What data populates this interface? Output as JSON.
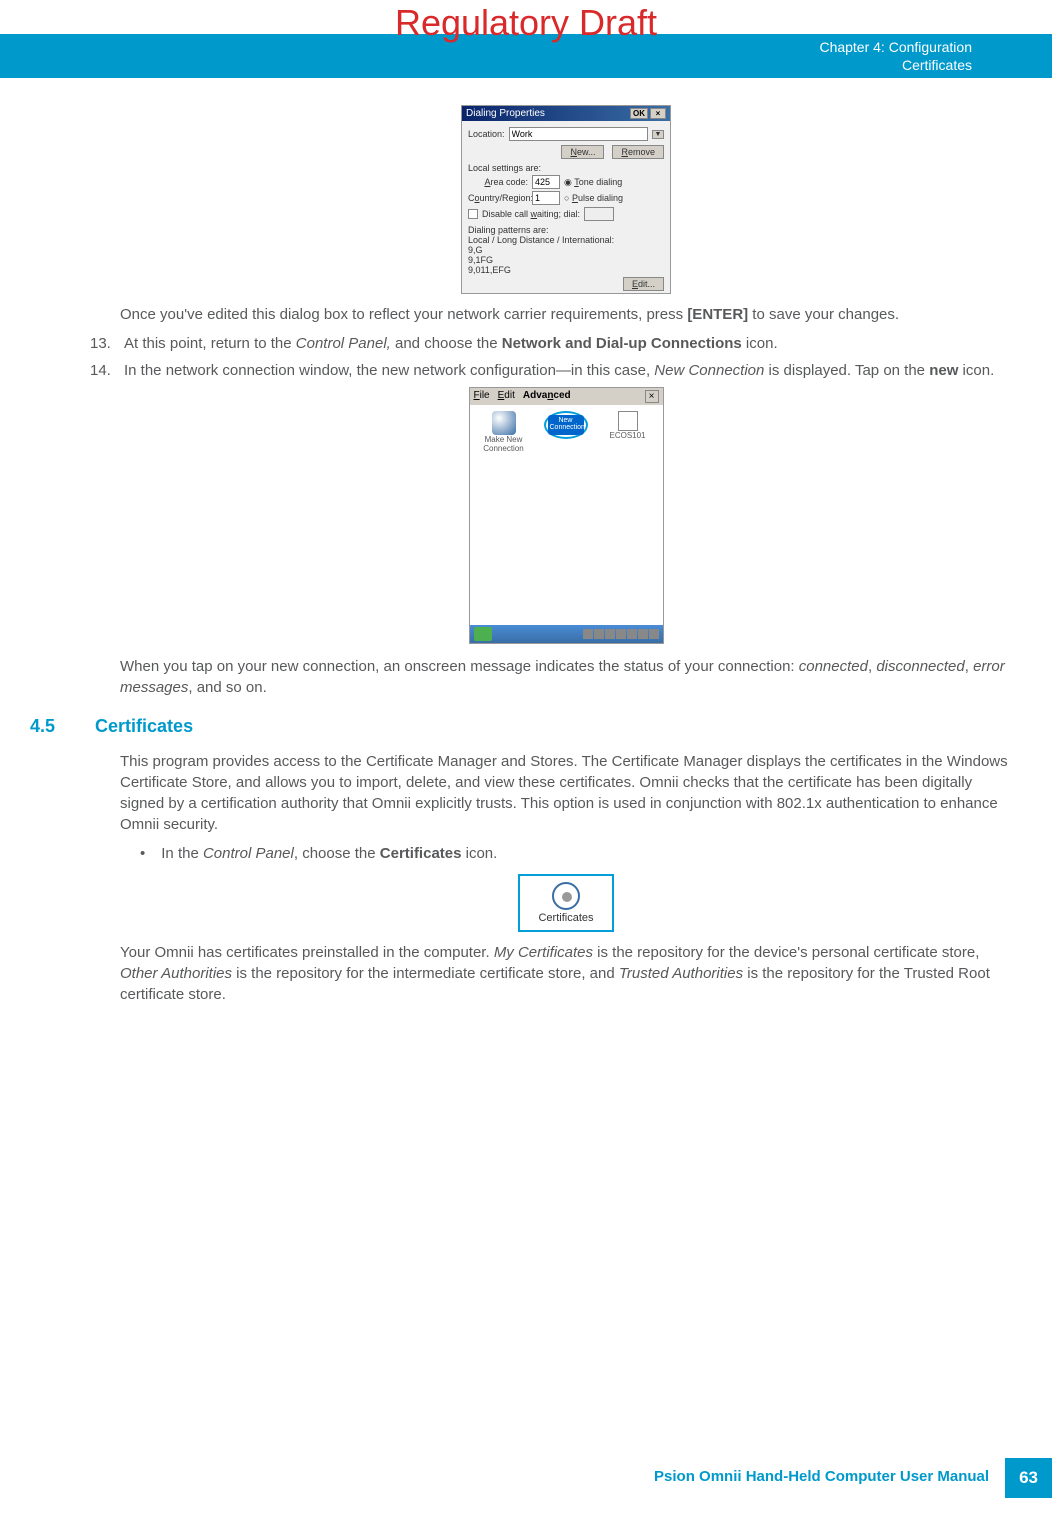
{
  "watermark": "Regulatory Draft",
  "header": {
    "chapter": "Chapter 4:  Configuration",
    "section": "Certificates"
  },
  "dialog1": {
    "title": "Dialing Properties",
    "ok": "OK",
    "close": "×",
    "location_label": "Location:",
    "location_value": "Work",
    "new_btn": "New...",
    "remove_btn": "Remove",
    "local_settings": "Local settings are:",
    "area_code_label": "Area code:",
    "area_code_value": "425",
    "country_label": "Country/Region:",
    "country_value": "1",
    "tone": "Tone dialing",
    "pulse": "Pulse dialing",
    "disable_wait": "Disable call waiting; dial:",
    "patterns_label": "Dialing patterns are:",
    "patterns_sub": "Local / Long Distance / International:",
    "p1": "9,G",
    "p2": "9,1FG",
    "p3": "9,011,EFG",
    "edit_btn": "Edit..."
  },
  "para1_pre": "Once you've edited this dialog box to reflect your network carrier requirements, press ",
  "para1_enter": "[ENTER]",
  "para1_post": " to save your changes.",
  "step13": {
    "num": "13.",
    "pre": "At this point, return to the ",
    "cp": "Control Panel,",
    "mid": " and choose the ",
    "bold": "Network and Dial-up Connections",
    "post": " icon."
  },
  "step14": {
    "num": "14.",
    "pre": "In the network connection window, the new network configuration—in this case, ",
    "nc": "New Connection",
    "mid": " is displayed. Tap on the ",
    "bold": "new",
    "post": " icon."
  },
  "conn_window": {
    "menu_file": "File",
    "menu_edit": "Edit",
    "menu_advanced": "Advanced",
    "close": "×",
    "make_new": "Make New Connection",
    "new_label": "New Connection",
    "ecos": "ECOS101"
  },
  "para2": {
    "pre": "When you tap on your new connection, an onscreen message indicates the status of your connection: ",
    "connected": "connected",
    "c1": ", ",
    "disconnected": "disconnected",
    "c2": ", ",
    "errors": "error messages",
    "post": ", and so on."
  },
  "section": {
    "num": "4.5",
    "title": "Certificates"
  },
  "para3": "This program provides access to the Certificate Manager and Stores. The Certificate Manager displays the certificates in the Windows Certificate Store, and allows you to import, delete, and view these certificates. Omnii checks that the certificate has been digitally signed by a certification authority that Omnii explicitly trusts. This option is used in conjunction with 802.1x authentication to enhance Omnii security.",
  "bullet": {
    "dot": "•",
    "pre": "In the ",
    "cp": "Control Panel",
    "mid": ", choose the ",
    "bold": "Certificates",
    "post": " icon."
  },
  "cert_label": "Certificates",
  "para4": {
    "pre": "Your Omnii has certificates preinstalled in the computer. ",
    "mycert": "My Certificates",
    "mid1": " is the repository for the device's personal certificate store, ",
    "other": "Other Authorities",
    "mid2": " is the repository for the intermediate certificate store, and ",
    "trusted": "Trusted Authorities",
    "post": " is the repository for the Trusted Root certificate store."
  },
  "footer": {
    "text": "Psion Omnii Hand-Held Computer User Manual",
    "page": "63"
  }
}
